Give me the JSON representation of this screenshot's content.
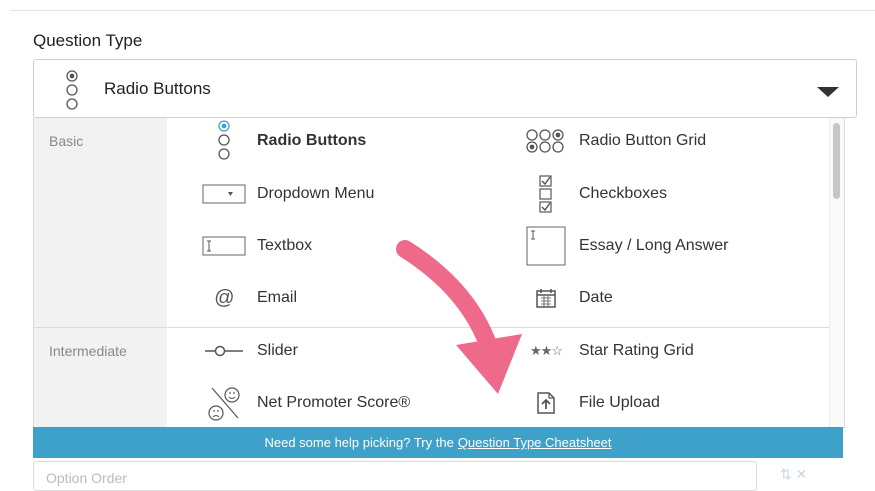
{
  "field_label": "Question Type",
  "selected": {
    "label": "Radio Buttons",
    "icon": "radio-buttons-icon"
  },
  "categories": [
    {
      "name": "Basic"
    },
    {
      "name": "Intermediate"
    }
  ],
  "options": {
    "radio_buttons": "Radio Buttons",
    "radio_button_grid": "Radio Button Grid",
    "dropdown_menu": "Dropdown Menu",
    "checkboxes": "Checkboxes",
    "textbox": "Textbox",
    "essay": "Essay / Long Answer",
    "email": "Email",
    "date": "Date",
    "slider": "Slider",
    "star_rating_grid": "Star Rating Grid",
    "nps": "Net Promoter Score®",
    "file_upload": "File Upload"
  },
  "help": {
    "text": "Need some help picking? Try the",
    "link": "Question Type Cheatsheet"
  },
  "below_field_placeholder": "Option Order",
  "colors": {
    "accent": "#3da1c9",
    "arrow": "#ef6a8a"
  }
}
